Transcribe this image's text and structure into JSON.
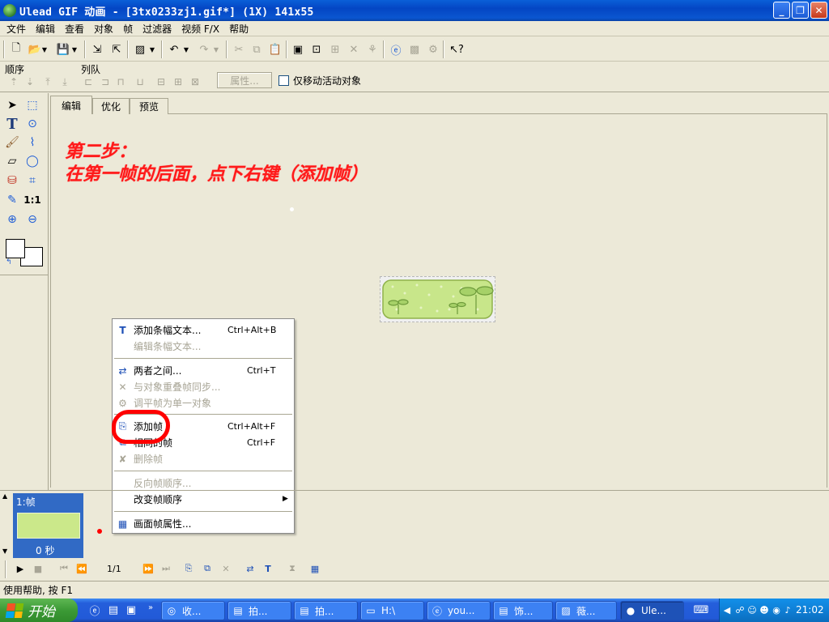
{
  "window": {
    "title": "Ulead GIF 动画 - [3tx0233zj1.gif*] (1X) 141x55",
    "minimize": "_",
    "maximize": "❐",
    "close": "✕"
  },
  "menu": [
    "文件",
    "编辑",
    "查看",
    "对象",
    "帧",
    "过滤器",
    "视频 F/X",
    "帮助"
  ],
  "toolbar2": {
    "order_label": "顺序",
    "queue_label": "列队",
    "properties_button": "属性...",
    "only_move_active_label": "仅移动活动对象"
  },
  "tabs": [
    "编辑",
    "优化",
    "预览"
  ],
  "annotation": {
    "line1": "第二步：",
    "line2": "在第一帧的后面，点下右键（添加帧）"
  },
  "context_menu": {
    "items": [
      {
        "label": "添加条幅文本...",
        "shortcut": "Ctrl+Alt+B",
        "icon": "banner-text-icon",
        "enabled": true
      },
      {
        "label": "编辑条幅文本...",
        "shortcut": "",
        "icon": "",
        "enabled": false
      },
      {
        "label": "两者之间...",
        "shortcut": "Ctrl+T",
        "icon": "tween-icon",
        "enabled": true
      },
      {
        "label": "与对象重叠帧同步...",
        "shortcut": "",
        "icon": "sync-icon",
        "enabled": false
      },
      {
        "label": "调平帧为单一对象",
        "shortcut": "",
        "icon": "flatten-icon",
        "enabled": false
      },
      {
        "label": "添加帧",
        "shortcut": "Ctrl+Alt+F",
        "icon": "add-frame-icon",
        "enabled": true
      },
      {
        "label": "相同的帧",
        "shortcut": "Ctrl+F",
        "icon": "duplicate-frame-icon",
        "enabled": true
      },
      {
        "label": "删除帧",
        "shortcut": "",
        "icon": "delete-frame-icon",
        "enabled": false
      },
      {
        "label": "反向帧顺序...",
        "shortcut": "",
        "icon": "",
        "enabled": false
      },
      {
        "label": "改变帧顺序",
        "shortcut": "",
        "icon": "",
        "enabled": true,
        "submenu": "▶"
      },
      {
        "label": "画面帧属性...",
        "shortcut": "",
        "icon": "frame-properties-icon",
        "enabled": true
      }
    ]
  },
  "frame_panel": {
    "frame_label": "1:帧",
    "frame_time": "0 秒"
  },
  "playback": {
    "frame_counter": "1/1"
  },
  "status_bar": "使用帮助, 按 F1",
  "taskbar": {
    "start": "开始",
    "tasks": [
      {
        "label": "收...",
        "icon": "folder-icon"
      },
      {
        "label": "拍...",
        "icon": "document-icon"
      },
      {
        "label": "拍...",
        "icon": "document-icon"
      },
      {
        "label": "H:\\",
        "icon": "drive-icon"
      },
      {
        "label": "you...",
        "icon": "browser-icon"
      },
      {
        "label": "饰...",
        "icon": "document-icon"
      },
      {
        "label": "薇...",
        "icon": "image-icon"
      },
      {
        "label": "Ule...",
        "icon": "ulead-icon",
        "active": true
      }
    ],
    "clock": "21:02"
  },
  "colors": {
    "annotation_red": "#ff1a1a",
    "titlebar_blue": "#0a56d0",
    "selection_blue": "#316ac5",
    "highlight_circle": "#ff0000"
  }
}
